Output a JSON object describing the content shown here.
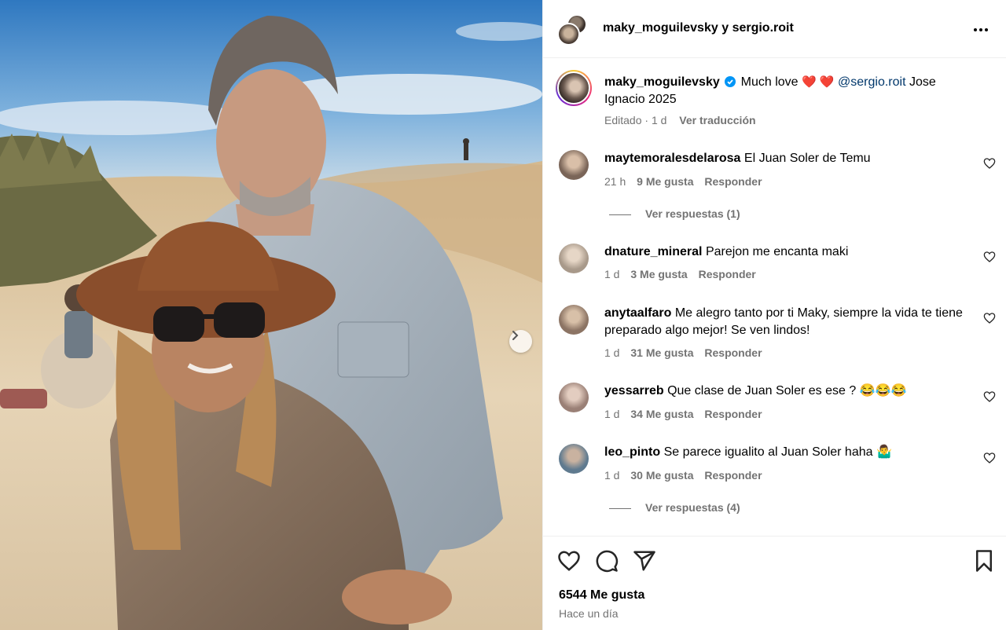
{
  "header": {
    "user1": "maky_moguilevsky",
    "joiner": "y",
    "user2": "sergio.roit"
  },
  "caption": {
    "username": "maky_moguilevsky",
    "text_before": "Much love",
    "hearts": "❤️ ❤️",
    "mention": "@sergio.roit",
    "text_after": "Jose Ignacio 2025",
    "edited": "Editado",
    "age": "1 d",
    "see_translation": "Ver traducción"
  },
  "comments": [
    {
      "username": "maytemoralesdelarosa",
      "text": "El Juan Soler de Temu",
      "age": "21 h",
      "likes": "9 Me gusta",
      "reply": "Responder",
      "replies": "Ver respuestas (1)",
      "avatar_color": "#7a6558"
    },
    {
      "username": "dnature_mineral",
      "text": "Parejon me encanta maki",
      "age": "1 d",
      "likes": "3 Me gusta",
      "reply": "Responder",
      "avatar_color": "#a8998a"
    },
    {
      "username": "anytaalfaro",
      "text": "Me alegro tanto por ti Maky, siempre la vida te tiene preparado algo mejor! Se ven lindos!",
      "age": "1 d",
      "likes": "31 Me gusta",
      "reply": "Responder",
      "avatar_color": "#8c7464"
    },
    {
      "username": "yessarreb",
      "text": "Que clase de Juan Soler es ese ? 😂😂😂",
      "age": "1 d",
      "likes": "34 Me gusta",
      "reply": "Responder",
      "avatar_color": "#9a8076"
    },
    {
      "username": "leo_pinto",
      "text": "Se parece igualito al Juan Soler haha 🤷‍♂️",
      "age": "1 d",
      "likes": "30 Me gusta",
      "reply": "Responder",
      "replies": "Ver respuestas (4)",
      "avatar_color": "#5f7a8f"
    }
  ],
  "footer": {
    "likes": "6544 Me gusta",
    "time": "Hace un día"
  },
  "icons": {
    "more": "more-options-icon",
    "like": "heart-icon",
    "comment": "comment-icon",
    "share": "share-icon",
    "save": "bookmark-icon",
    "next": "chevron-right-icon",
    "verified": "verified-badge-icon"
  },
  "colors": {
    "link": "#00376b",
    "muted": "#737373",
    "verified": "#0095f6"
  }
}
